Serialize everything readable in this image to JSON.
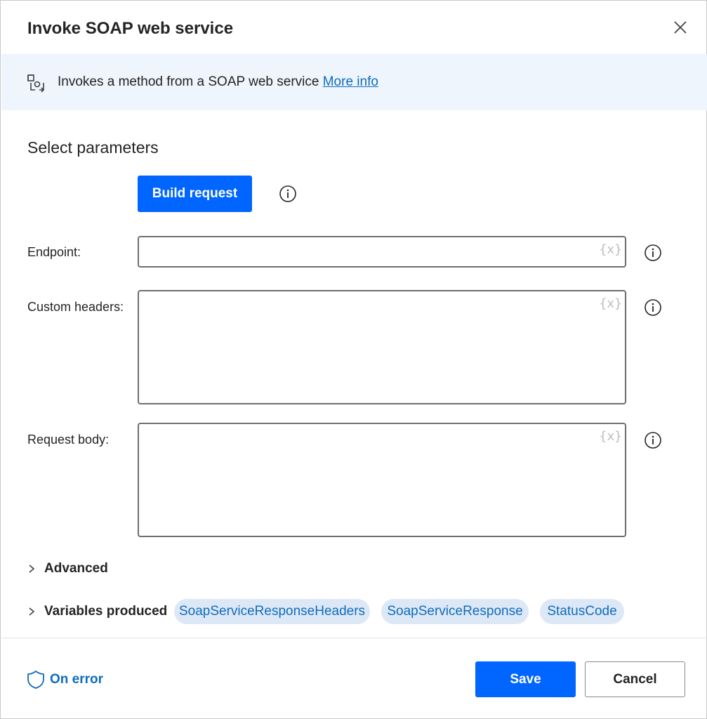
{
  "dialog": {
    "title": "Invoke SOAP web service",
    "close_icon": "close-icon"
  },
  "banner": {
    "icon": "soap-action-icon",
    "description": "Invokes a method from a SOAP web service",
    "link_text": "More info"
  },
  "parameters": {
    "section_title": "Select parameters",
    "build_request_label": "Build request",
    "fields": [
      {
        "label": "Endpoint:",
        "value": "",
        "variable_button": "{x}"
      },
      {
        "label": "Custom headers:",
        "value": "",
        "variable_button": "{x}"
      },
      {
        "label": "Request body:",
        "value": "",
        "variable_button": "{x}"
      }
    ]
  },
  "advanced": {
    "label": "Advanced"
  },
  "variables_produced": {
    "label": "Variables produced",
    "items": [
      "SoapServiceResponseHeaders",
      "SoapServiceResponse",
      "StatusCode"
    ]
  },
  "footer": {
    "on_error_label": "On error",
    "save_label": "Save",
    "cancel_label": "Cancel"
  },
  "colors": {
    "primary": "#0066ff",
    "link": "#0f6cbd",
    "banner_bg": "#eff5fc",
    "chip_bg": "#dde8f6"
  }
}
